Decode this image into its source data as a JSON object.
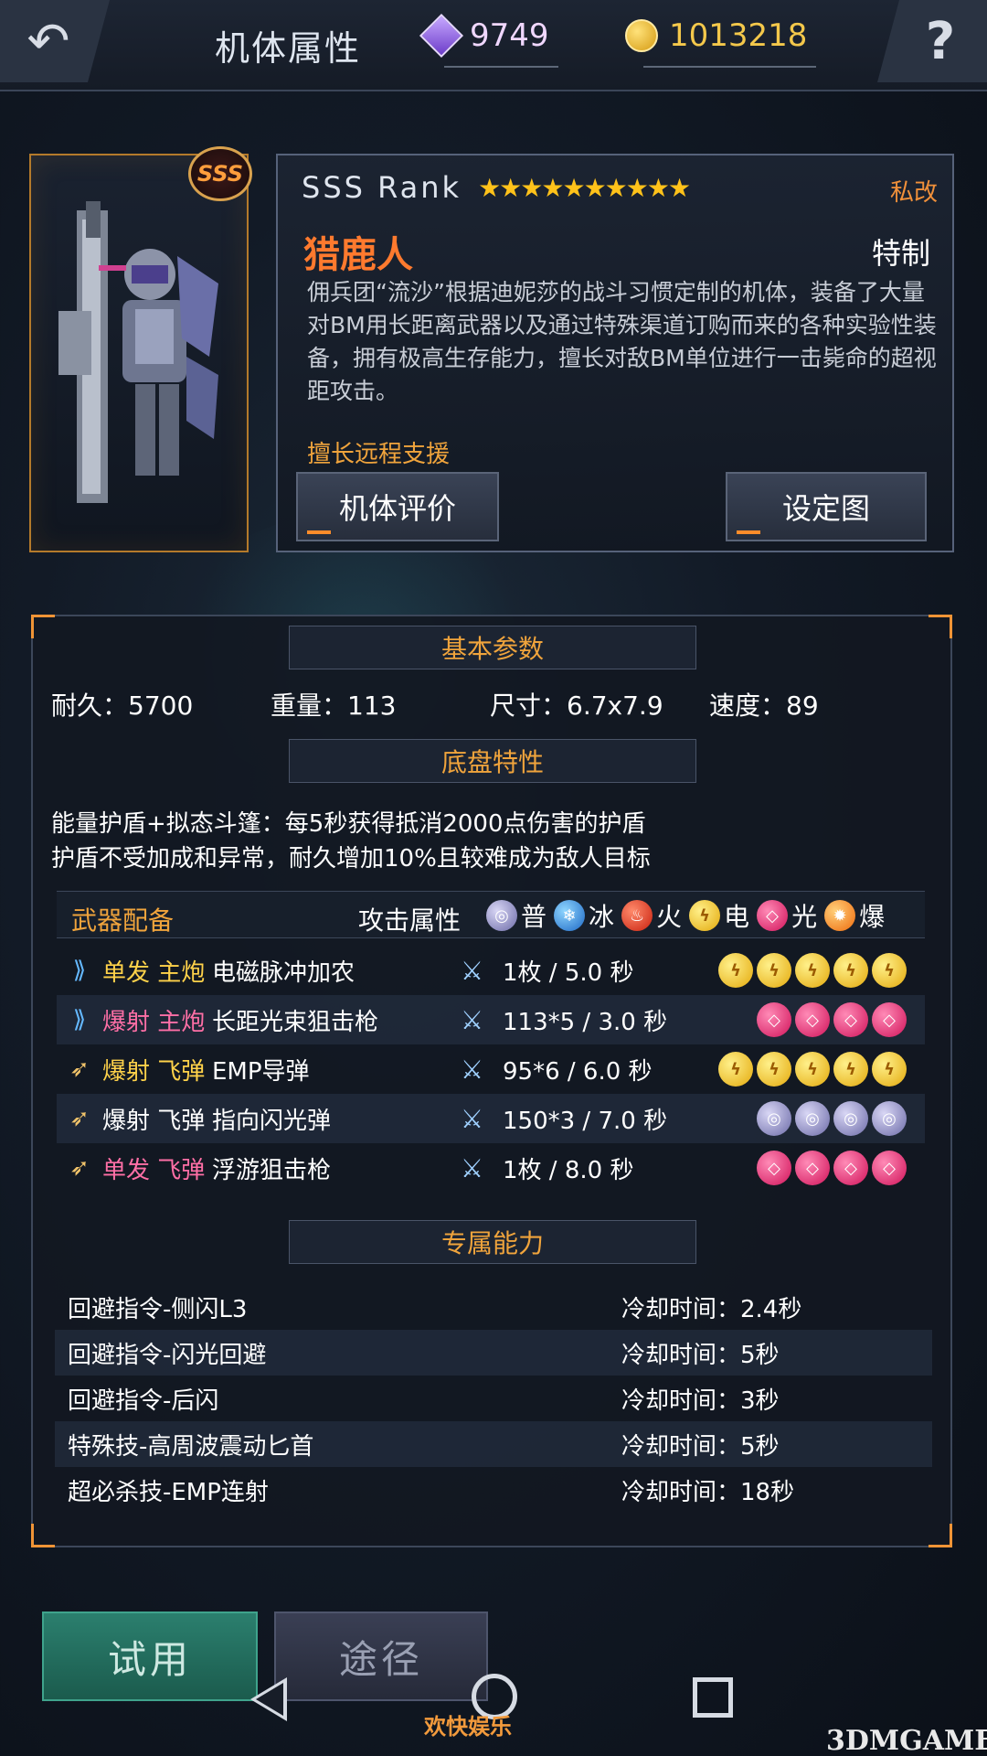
{
  "header": {
    "back_icon": "back-arrow-icon",
    "title": "机体属性",
    "gems": "9749",
    "coins": "1013218",
    "help_icon": "question-mark-icon"
  },
  "mech": {
    "rank_badge": "SSS",
    "rank_text": "SSS Rank",
    "stars": "★★★★★★★★★★",
    "star_count": 10,
    "private_tag": "私改",
    "name": "猎鹿人",
    "type": "特制",
    "description": "佣兵团“流沙”根据迪妮莎的战斗习惯定制的机体，装备了大量对BM用长距离武器以及通过特殊渠道订购而来的各种实验性装备，拥有极高生存能力，擅长对敌BM单位进行一击毙命的超视距攻击。",
    "specialty": "擅长远程支援",
    "eval_button": "机体评价",
    "setting_button": "设定图"
  },
  "basic": {
    "heading": "基本参数",
    "durability": "耐久：5700",
    "weight": "重量：113",
    "size": "尺寸：6.7x7.9",
    "speed": "速度：89"
  },
  "chassis": {
    "heading": "底盘特性",
    "line1": "能量护盾+拟态斗篷：每5秒获得抵消2000点伤害的护盾",
    "line2": "护盾不受加成和异常，耐久增加10%且较难成为敌人目标"
  },
  "weapons": {
    "heading": "武器配备",
    "attr_label": "攻击属性",
    "attributes": [
      {
        "label": "普",
        "icon": "normal-element-icon"
      },
      {
        "label": "冰",
        "icon": "ice-element-icon"
      },
      {
        "label": "火",
        "icon": "fire-element-icon"
      },
      {
        "label": "电",
        "icon": "electric-element-icon"
      },
      {
        "label": "光",
        "icon": "light-element-icon"
      },
      {
        "label": "爆",
        "icon": "explosive-element-icon"
      }
    ],
    "rows": [
      {
        "fire": "单发 主炮",
        "name": "电磁脉冲加农",
        "ammo": "1枚 / 5.0 秒",
        "element": "electric",
        "count": 5
      },
      {
        "fire": "爆射 主炮",
        "name": "长距光束狙击枪",
        "ammo": "113*5 / 3.0 秒",
        "element": "light",
        "count": 4
      },
      {
        "fire": "爆射 飞弹",
        "name": "EMP导弹",
        "ammo": "95*6 / 6.0 秒",
        "element": "electric",
        "count": 5
      },
      {
        "fire": "爆射 飞弹",
        "name": "指向闪光弹",
        "ammo": "150*3 / 7.0 秒",
        "element": "normal",
        "count": 4
      },
      {
        "fire": "单发 飞弹",
        "name": "浮游狙击枪",
        "ammo": "1枚 / 8.0 秒",
        "element": "light",
        "count": 4
      }
    ]
  },
  "exclusive": {
    "heading": "专属能力",
    "rows": [
      {
        "name": "回避指令-侧闪L3",
        "cooldown": "冷却时间：2.4秒"
      },
      {
        "name": "回避指令-闪光回避",
        "cooldown": "冷却时间：5秒"
      },
      {
        "name": "回避指令-后闪",
        "cooldown": "冷却时间：3秒"
      },
      {
        "name": "特殊技-高周波震动匕首",
        "cooldown": "冷却时间：5秒"
      },
      {
        "name": "超必杀技-EMP连射",
        "cooldown": "冷却时间：18秒"
      }
    ]
  },
  "footer": {
    "trial_button": "试用",
    "route_button": "途径",
    "watermark_left": "欢快娱乐",
    "watermark_right": "3DMGAME"
  },
  "colors": {
    "accent_orange": "#f0a43c",
    "name_orange": "#ff7a2e",
    "star_gold": "#ffc21a",
    "trial_green": "#2b7f6e"
  }
}
